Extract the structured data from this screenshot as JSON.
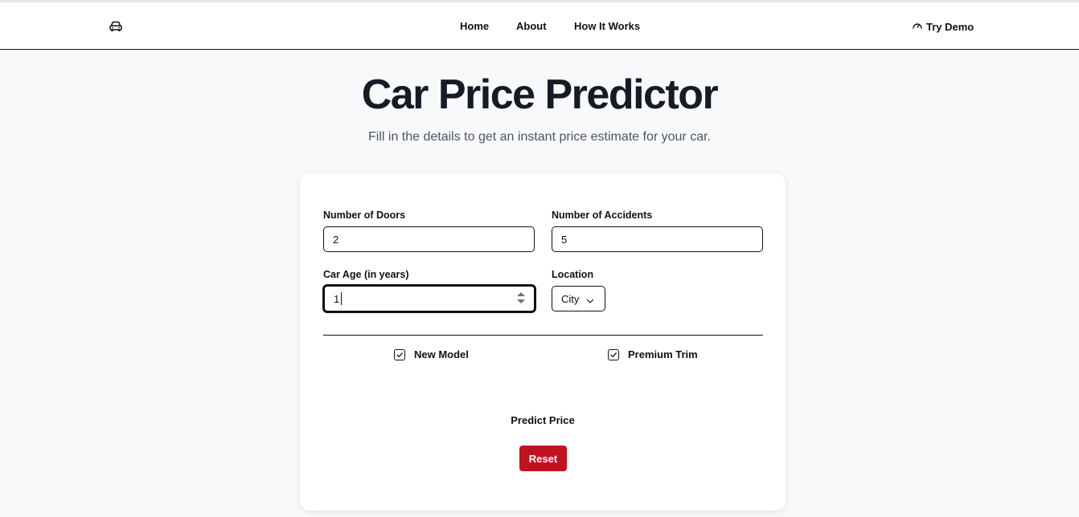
{
  "nav": {
    "brand_icon": "car-icon",
    "links": [
      "Home",
      "About",
      "How It Works"
    ],
    "cta": {
      "label": "Try Demo",
      "icon": "gauge-icon"
    }
  },
  "hero": {
    "title": "Car Price Predictor",
    "subtitle": "Fill in the details to get an instant price estimate for your car."
  },
  "form": {
    "doors": {
      "label": "Number of Doors",
      "value": "2"
    },
    "accidents": {
      "label": "Number of Accidents",
      "value": "5"
    },
    "age": {
      "label": "Car Age (in years)",
      "value": "1"
    },
    "location": {
      "label": "Location",
      "selected": "City"
    },
    "checkboxes": [
      {
        "label": "New Model",
        "checked": true
      },
      {
        "label": "Premium Trim",
        "checked": true
      }
    ],
    "predict_label": "Predict Price",
    "reset_label": "Reset"
  },
  "colors": {
    "background": "#f8f9fa",
    "card": "#ffffff",
    "title": "#161b26",
    "subtitle": "#4b5563",
    "reset_button": "#c1121f"
  }
}
